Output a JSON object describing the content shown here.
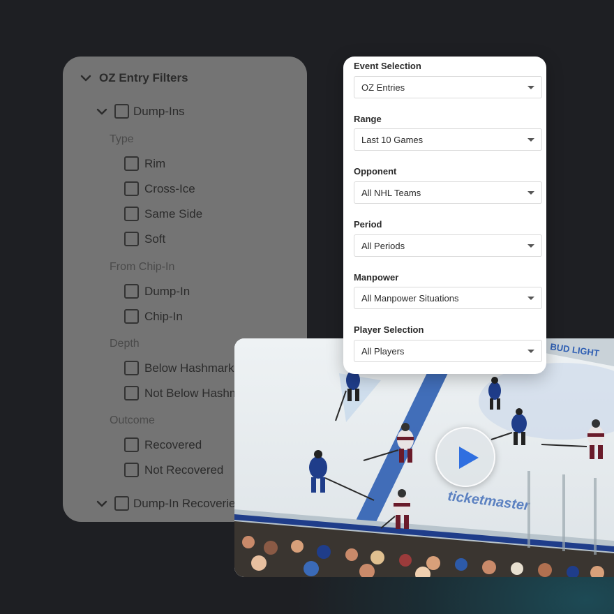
{
  "filters": {
    "title": "OZ Entry Filters",
    "group1": {
      "label": "Dump-Ins"
    },
    "sections": [
      {
        "label": "Type",
        "options": [
          "Rim",
          "Cross-Ice",
          "Same Side",
          "Soft"
        ]
      },
      {
        "label": "From Chip-In",
        "options": [
          "Dump-In",
          "Chip-In"
        ]
      },
      {
        "label": "Depth",
        "options": [
          "Below Hashmarks",
          "Not Below Hashmarks"
        ]
      },
      {
        "label": "Outcome",
        "options": [
          "Recovered",
          "Not Recovered"
        ]
      }
    ],
    "group2": {
      "label": "Dump-In Recoveries"
    }
  },
  "selection": {
    "fields": [
      {
        "label": "Event Selection",
        "value": "OZ Entries"
      },
      {
        "label": "Range",
        "value": "Last 10 Games"
      },
      {
        "label": "Opponent",
        "value": "All NHL Teams"
      },
      {
        "label": "Period",
        "value": "All Periods"
      },
      {
        "label": "Manpower",
        "value": "All Manpower Situations"
      },
      {
        "label": "Player Selection",
        "value": "All Players"
      }
    ]
  },
  "video": {
    "rink_text": "ticketmaster",
    "board_text": "BUD LIGHT",
    "colors": {
      "ice": "#e9eef1",
      "blue_line": "#2f5fb3",
      "play_icon": "#2f6fe0",
      "home": "#1f3d8a",
      "away": "#6a1b2a"
    }
  },
  "icons": {
    "collapse": "chevron-down-icon",
    "dropdown": "caret-down-icon",
    "play": "play-icon"
  }
}
